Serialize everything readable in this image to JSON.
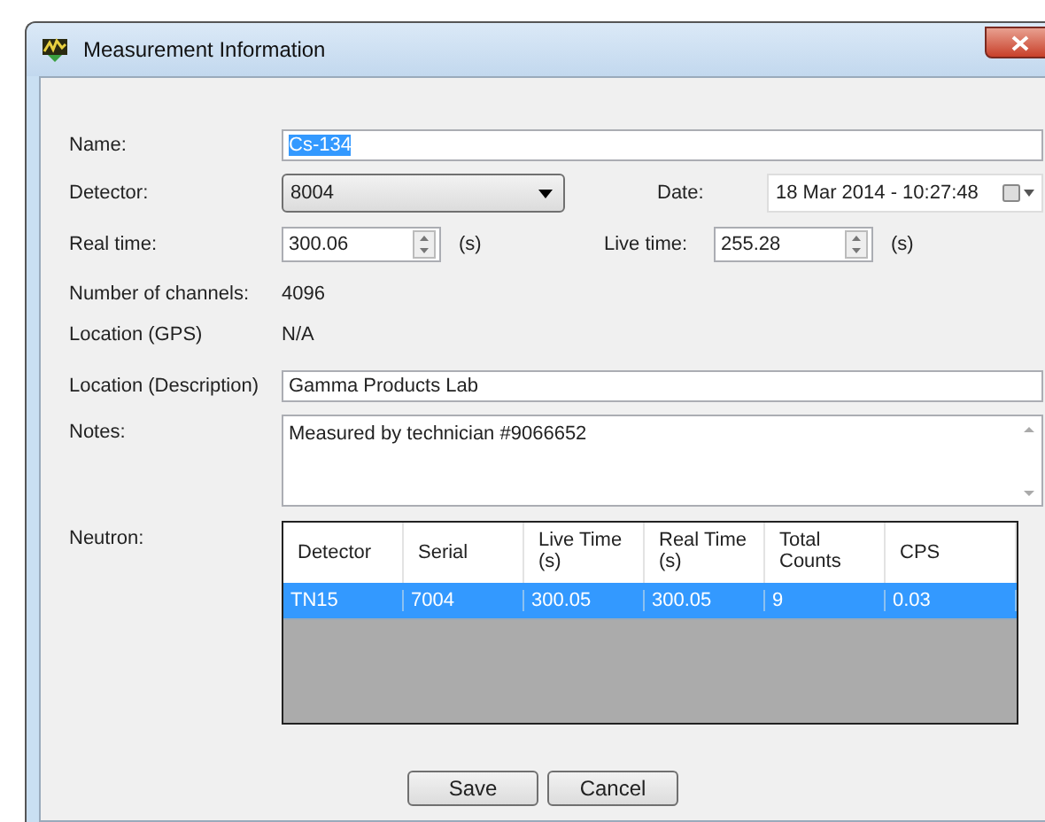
{
  "window": {
    "title": "Measurement Information"
  },
  "name": {
    "label": "Name:",
    "value": "Cs-134",
    "selected": true
  },
  "detector": {
    "label": "Detector:",
    "value": "8004"
  },
  "date": {
    "label": "Date:",
    "value": "18 Mar 2014 -  10:27:48"
  },
  "real_time": {
    "label": "Real time:",
    "value": "300.06",
    "unit": "(s)"
  },
  "live_time": {
    "label": "Live time:",
    "value": "255.28",
    "unit": "(s)"
  },
  "channels": {
    "label": "Number of channels:",
    "value": "4096"
  },
  "gps": {
    "label": "Location (GPS)",
    "value": "N/A"
  },
  "location": {
    "label": "Location (Description)",
    "value": "Gamma Products Lab"
  },
  "notes": {
    "label": "Notes:",
    "value": "Measured by technician #9066652"
  },
  "neutron": {
    "label": "Neutron:",
    "columns": [
      "Detector",
      "Serial",
      "Live Time (s)",
      "Real Time (s)",
      "Total Counts",
      "CPS"
    ],
    "rows": [
      {
        "cells": [
          "TN15",
          "7004",
          "300.05",
          "300.05",
          "9",
          "0.03"
        ],
        "selected": true
      }
    ]
  },
  "buttons": [
    "Save",
    "Cancel"
  ]
}
